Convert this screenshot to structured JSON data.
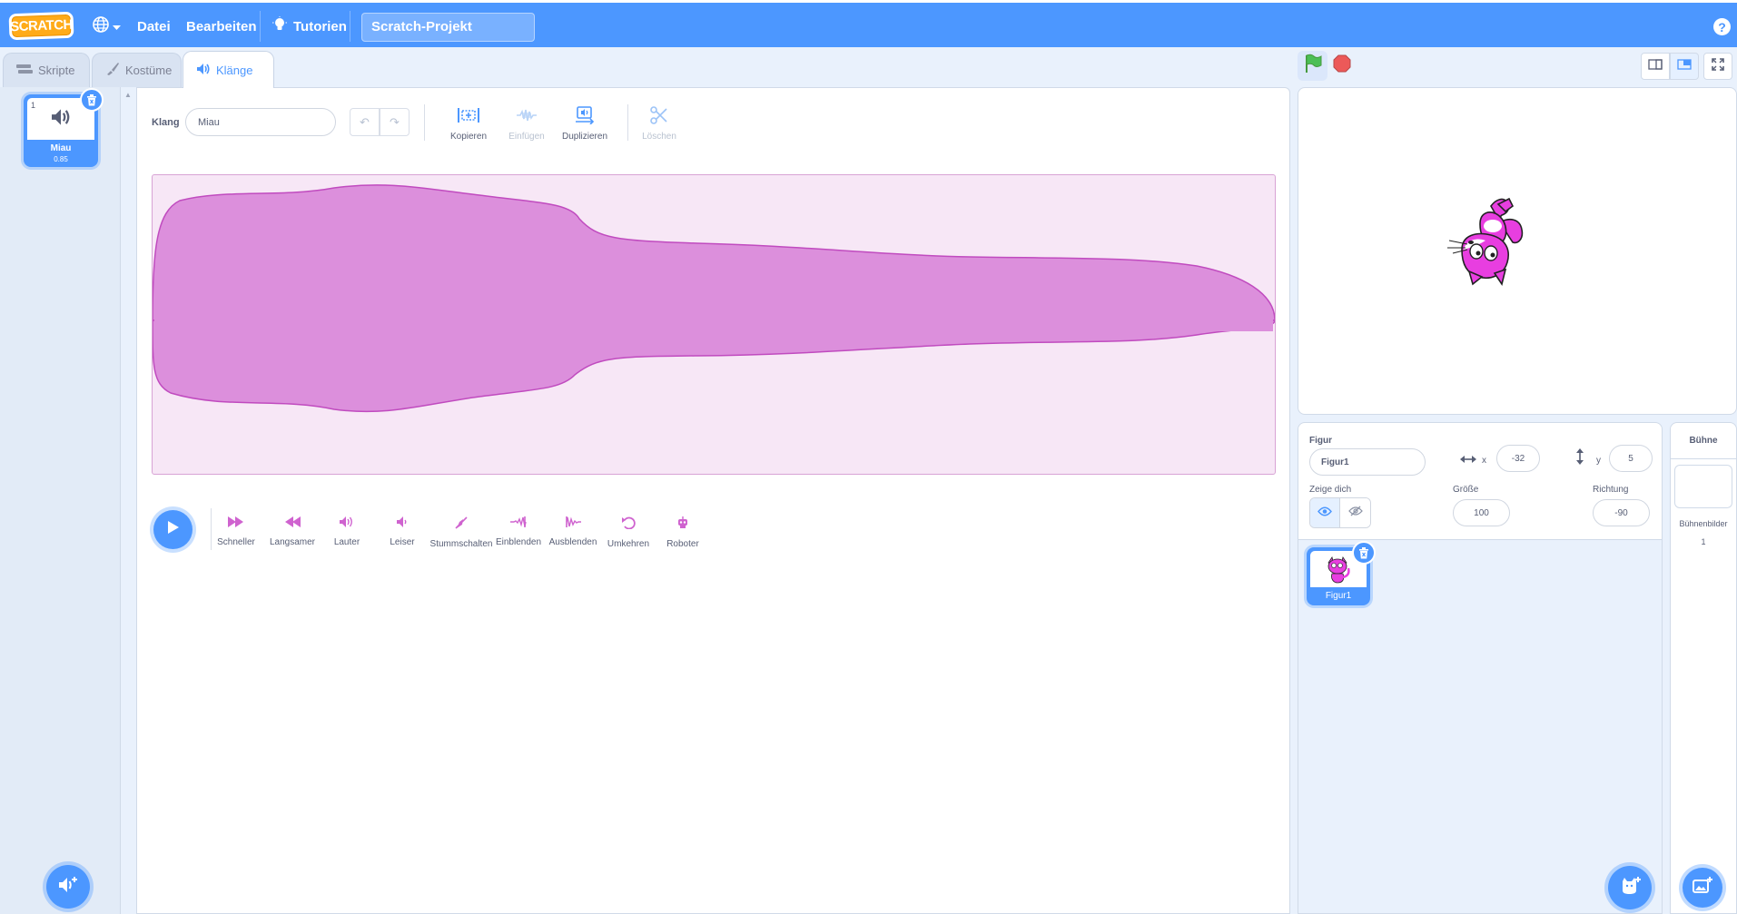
{
  "menubar": {
    "logo": "SCRATCH",
    "file": "Datei",
    "edit": "Bearbeiten",
    "tutorials": "Tutorien",
    "project_title": "Scratch-Projekt",
    "help": "?"
  },
  "tabs": [
    {
      "label": "Skripte",
      "icon": "code-icon"
    },
    {
      "label": "Kostüme",
      "icon": "brush-icon"
    },
    {
      "label": "Klänge",
      "icon": "speaker-icon"
    }
  ],
  "sound_list": {
    "items": [
      {
        "number": "1",
        "name": "Miau",
        "duration": "0.85"
      }
    ]
  },
  "editor": {
    "sound_label": "Klang",
    "sound_name": "Miau",
    "tools": [
      {
        "label": "Kopieren",
        "icon": "copy-icon",
        "enabled": true
      },
      {
        "label": "Einfügen",
        "icon": "paste-icon",
        "enabled": false
      },
      {
        "label": "Duplizieren",
        "icon": "duplicate-icon",
        "enabled": true
      },
      {
        "label": "Löschen",
        "icon": "scissors-icon",
        "enabled": false
      }
    ],
    "effects": [
      {
        "label": "Schneller",
        "icon": "faster-icon"
      },
      {
        "label": "Langsamer",
        "icon": "slower-icon"
      },
      {
        "label": "Lauter",
        "icon": "louder-icon"
      },
      {
        "label": "Leiser",
        "icon": "softer-icon"
      },
      {
        "label": "Stummschalten",
        "icon": "mute-icon"
      },
      {
        "label": "Einblenden",
        "icon": "fade-in-icon"
      },
      {
        "label": "Ausblenden",
        "icon": "fade-out-icon"
      },
      {
        "label": "Umkehren",
        "icon": "reverse-icon"
      },
      {
        "label": "Roboter",
        "icon": "robot-icon"
      }
    ],
    "waveform_color": "#cf63cf"
  },
  "sprite_info": {
    "sprite_label": "Figur",
    "sprite_name": "Figur1",
    "x_label": "x",
    "x_value": "-32",
    "y_label": "y",
    "y_value": "5",
    "show_label": "Zeige dich",
    "size_label": "Größe",
    "size_value": "100",
    "direction_label": "Richtung",
    "direction_value": "-90"
  },
  "sprites": [
    {
      "name": "Figur1"
    }
  ],
  "stage_panel": {
    "title": "Bühne",
    "backdrops_label": "Bühnenbilder",
    "backdrops_count": "1"
  },
  "colors": {
    "primary": "#4c97ff",
    "sound": "#cf63cf",
    "green_flag": "#4cbf56",
    "stop": "#ec5959"
  }
}
